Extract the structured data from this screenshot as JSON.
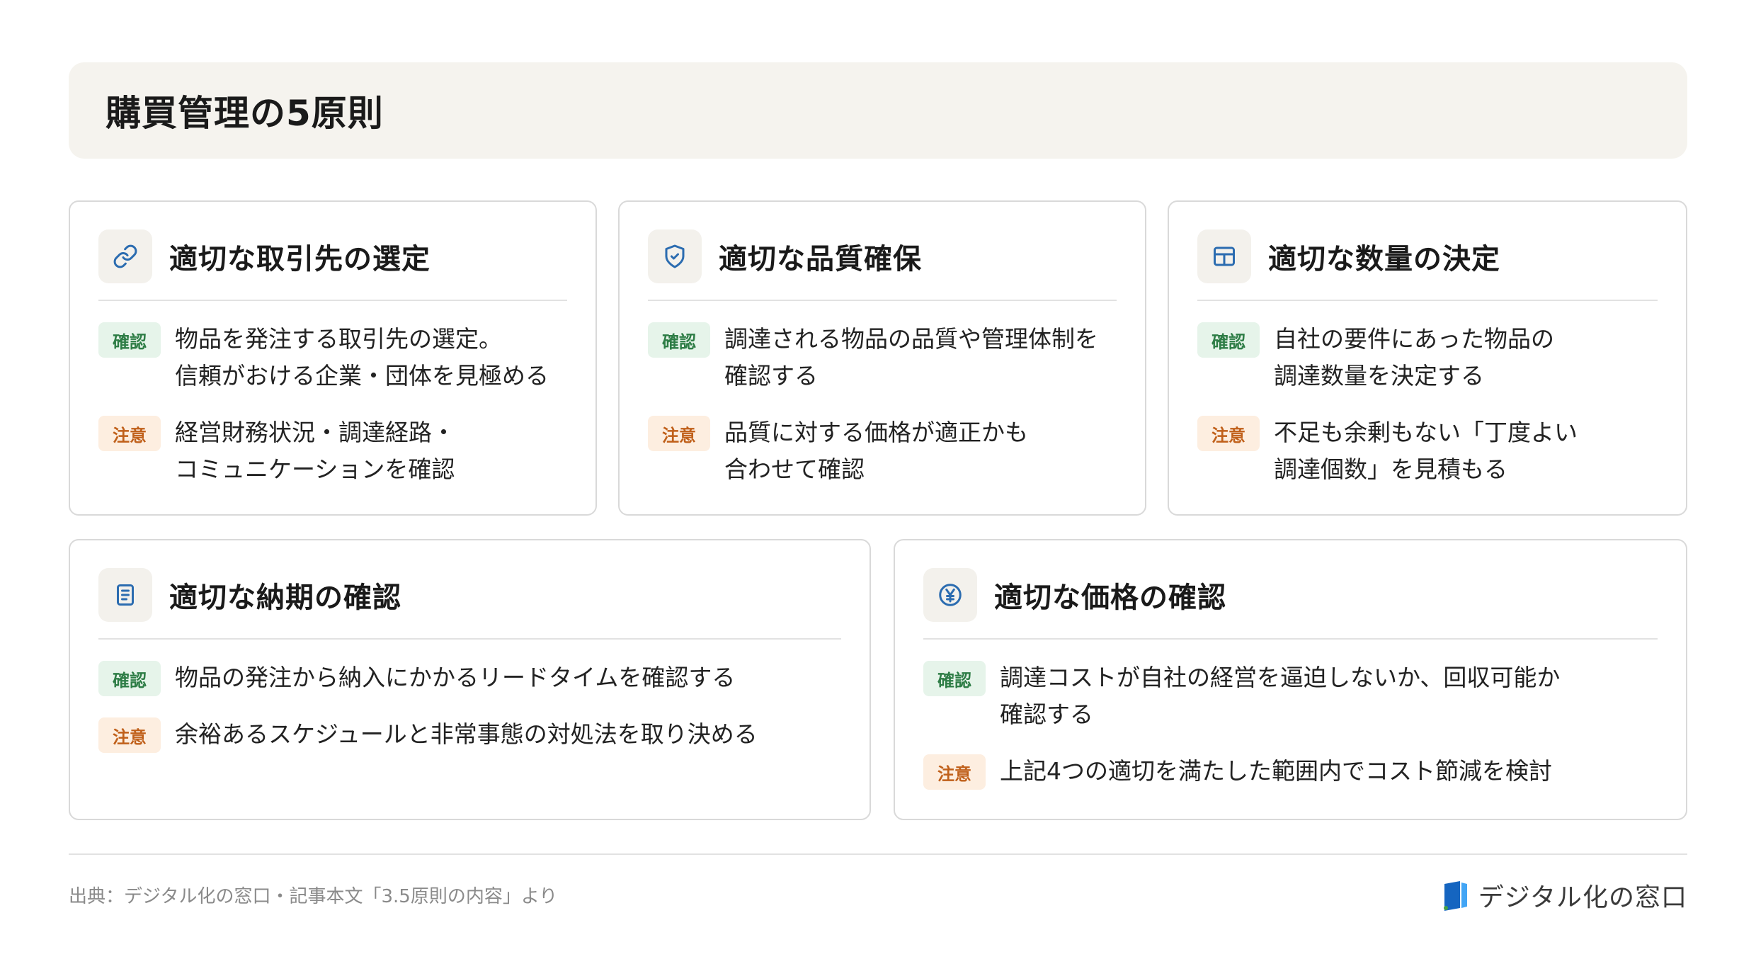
{
  "header": {
    "title": "購買管理の5原則"
  },
  "badges": {
    "confirm": "確認",
    "caution": "注意"
  },
  "cards": [
    {
      "icon": "link-icon",
      "title": "適切な取引先の選定",
      "confirm": "物品を発注する取引先の選定。\n信頼がおける企業・団体を見極める",
      "caution": "経営財務状況・調達経路・\nコミュニケーションを確認"
    },
    {
      "icon": "shield-check-icon",
      "title": "適切な品質確保",
      "confirm": "調達される物品の品質や管理体制を\n確認する",
      "caution": "品質に対する価格が適正かも\n合わせて確認"
    },
    {
      "icon": "grid-table-icon",
      "title": "適切な数量の決定",
      "confirm": "自社の要件にあった物品の\n調達数量を決定する",
      "caution": "不足も余剰もない「丁度よい\n調達個数」を見積もる"
    },
    {
      "icon": "document-icon",
      "title": "適切な納期の確認",
      "confirm": "物品の発注から納入にかかるリードタイムを確認する",
      "caution": "余裕あるスケジュールと非常事態の対処法を取り決める"
    },
    {
      "icon": "yen-circle-icon",
      "title": "適切な価格の確認",
      "confirm": "調達コストが自社の経営を逼迫しないか、回収可能か\n確認する",
      "caution": "上記4つの適切を満たした範囲内でコスト節減を検討"
    }
  ],
  "footer": {
    "source": "出典：デジタル化の窓口・記事本文「3.5原則の内容」より",
    "brand": "デジタル化の窓口"
  },
  "colors": {
    "icon_blue": "#2b6cb0",
    "confirm_green": "#2e7d46",
    "caution_orange": "#c0601a",
    "header_bg": "#f5f3ee"
  }
}
